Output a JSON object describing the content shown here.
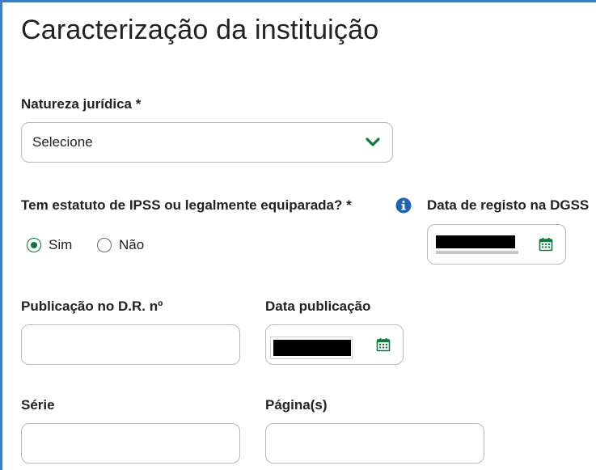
{
  "page": {
    "title": "Caracterização da instituição"
  },
  "fields": {
    "natureza": {
      "label": "Natureza jurídica *",
      "value": "Selecione"
    },
    "ipss": {
      "label": "Tem estatuto de IPSS ou legalmente equiparada? *",
      "options": [
        {
          "label": "Sim",
          "selected": true
        },
        {
          "label": "Não",
          "selected": false
        }
      ]
    },
    "data_registo": {
      "label": "Data de registo na DGSS",
      "value_redacted": true
    },
    "publicacao": {
      "label": "Publicação no D.R. nº",
      "value": ""
    },
    "data_publicacao": {
      "label": "Data publicação",
      "value_redacted": true
    },
    "serie": {
      "label": "Série",
      "value": ""
    },
    "paginas": {
      "label": "Página(s)",
      "value": ""
    }
  },
  "icons": {
    "chevron": "chevron-down-icon",
    "info": "info-icon",
    "calendar": "calendar-icon"
  },
  "colors": {
    "accent_green": "#0b7a3b",
    "info_blue": "#1f63b5",
    "frame_blue": "#3f7fc0",
    "border": "#b9b9b9"
  }
}
